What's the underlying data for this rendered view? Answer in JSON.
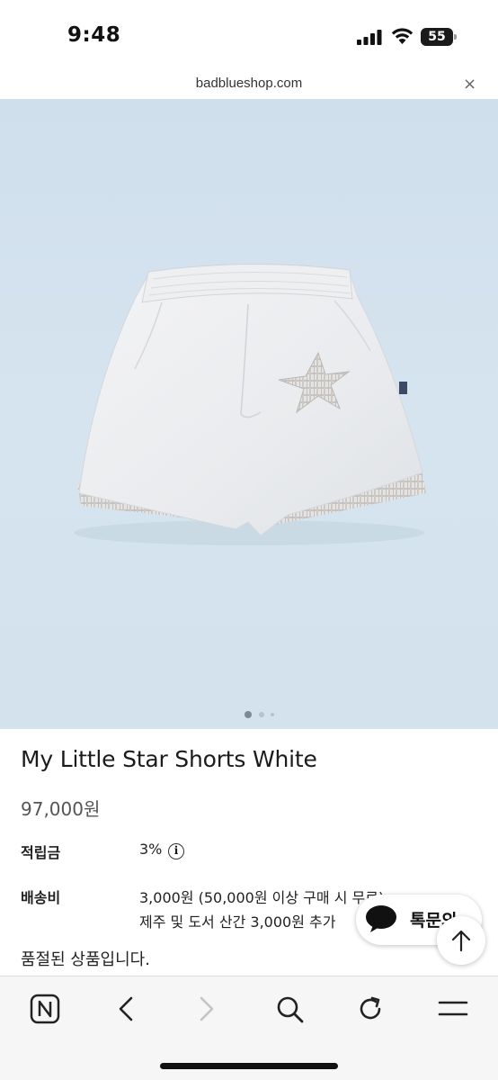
{
  "status_bar": {
    "time": "9:48",
    "battery": "55"
  },
  "url_bar": {
    "domain": "badblueshop.com",
    "close_icon": "×"
  },
  "product": {
    "image_alt_icon": "shorts-photo",
    "carousel": {
      "count": 3,
      "active": 1
    },
    "title": "My Little Star Shorts White",
    "price": "97,000원",
    "points_label": "적립금",
    "points_value": "3%",
    "info_icon": "i",
    "shipping_label": "배송비",
    "shipping_line1": "3,000원 (50,000원 이상 구매 시 무료)",
    "shipping_line2": "제주 및 도서 산간 3,000원 추가",
    "soldout_text": "품절된 상품입니다."
  },
  "floating": {
    "talk_label": "톡문의"
  },
  "toolbar": {
    "items": [
      "naver-home-icon",
      "back-icon",
      "forward-icon",
      "search-icon",
      "refresh-icon",
      "menu-icon"
    ]
  },
  "colors": {
    "image_bg": "#d3e2ed",
    "toolbar_bg": "#f6f6f6"
  }
}
